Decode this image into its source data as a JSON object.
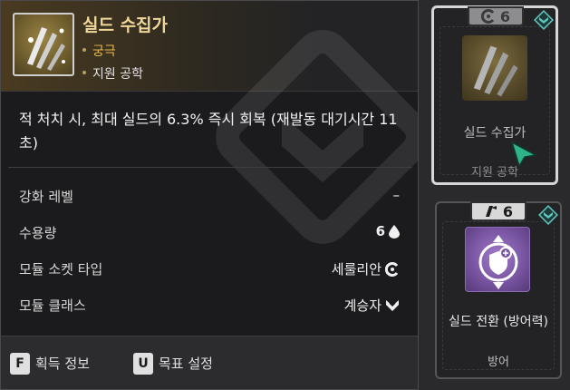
{
  "tooltip": {
    "title": "실드 수집가",
    "tier": "궁극",
    "category": "지원 공학",
    "effect": "적 처치 시, 최대 실드의 6.3% 즉시 회복 (재발동 대기시간 11초)",
    "stats": [
      {
        "label": "강화 레벨",
        "value": "–",
        "icon": ""
      },
      {
        "label": "수용량",
        "value": "6",
        "icon": "drop-icon"
      },
      {
        "label": "모듈 소켓 타입",
        "value": "세룰리안",
        "icon": "cerulean-socket-icon"
      },
      {
        "label": "모듈 클래스",
        "value": "계승자",
        "icon": "descendant-class-icon"
      }
    ],
    "footer": [
      {
        "key": "F",
        "label": "획득 정보"
      },
      {
        "key": "U",
        "label": "목표 설정"
      }
    ]
  },
  "cards": [
    {
      "capacity": "6",
      "socket_icon": "cerulean-socket-icon",
      "name": "실드 수집가",
      "category": "지원 공학",
      "selected": true
    },
    {
      "capacity": "6",
      "socket_icon": "malachite-socket-icon",
      "name": "실드 전환 (방어력)",
      "category": "방어",
      "selected": false
    }
  ],
  "colors": {
    "tier": "#e9b94e",
    "title": "#f0d79a",
    "class_badge": "#5fc9c0",
    "cursor": "#2fb38a"
  }
}
